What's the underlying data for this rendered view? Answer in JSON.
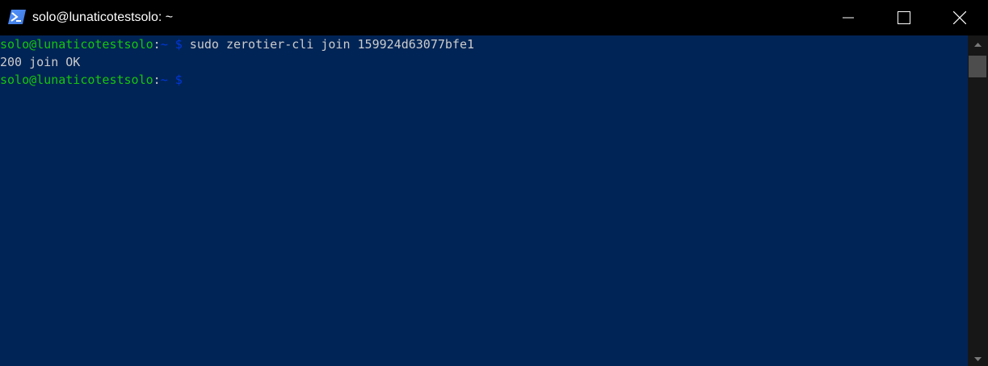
{
  "window": {
    "title": "solo@lunaticotestsolo: ~",
    "app_icon": "powershell-icon",
    "controls": {
      "minimize_icon": "minimize-icon",
      "maximize_icon": "maximize-icon",
      "close_icon": "close-icon"
    }
  },
  "terminal": {
    "lines": [
      {
        "user_host": "solo@lunaticotestsolo",
        "separator": ":",
        "path_prompt": "~ $",
        "command": " sudo zerotier-cli join 159924d63077bfe1"
      },
      {
        "output": "200 join OK"
      },
      {
        "user_host": "solo@lunaticotestsolo",
        "separator": ":",
        "path_prompt": "~ $",
        "command": ""
      }
    ]
  },
  "colors": {
    "background": "#012456",
    "titlebar": "#000000",
    "prompt_user": "#16c60c",
    "prompt_path": "#0037da",
    "text": "#cccccc"
  },
  "scrollbar": {
    "up_icon": "scroll-up-arrow-icon",
    "down_icon": "scroll-down-arrow-icon"
  }
}
